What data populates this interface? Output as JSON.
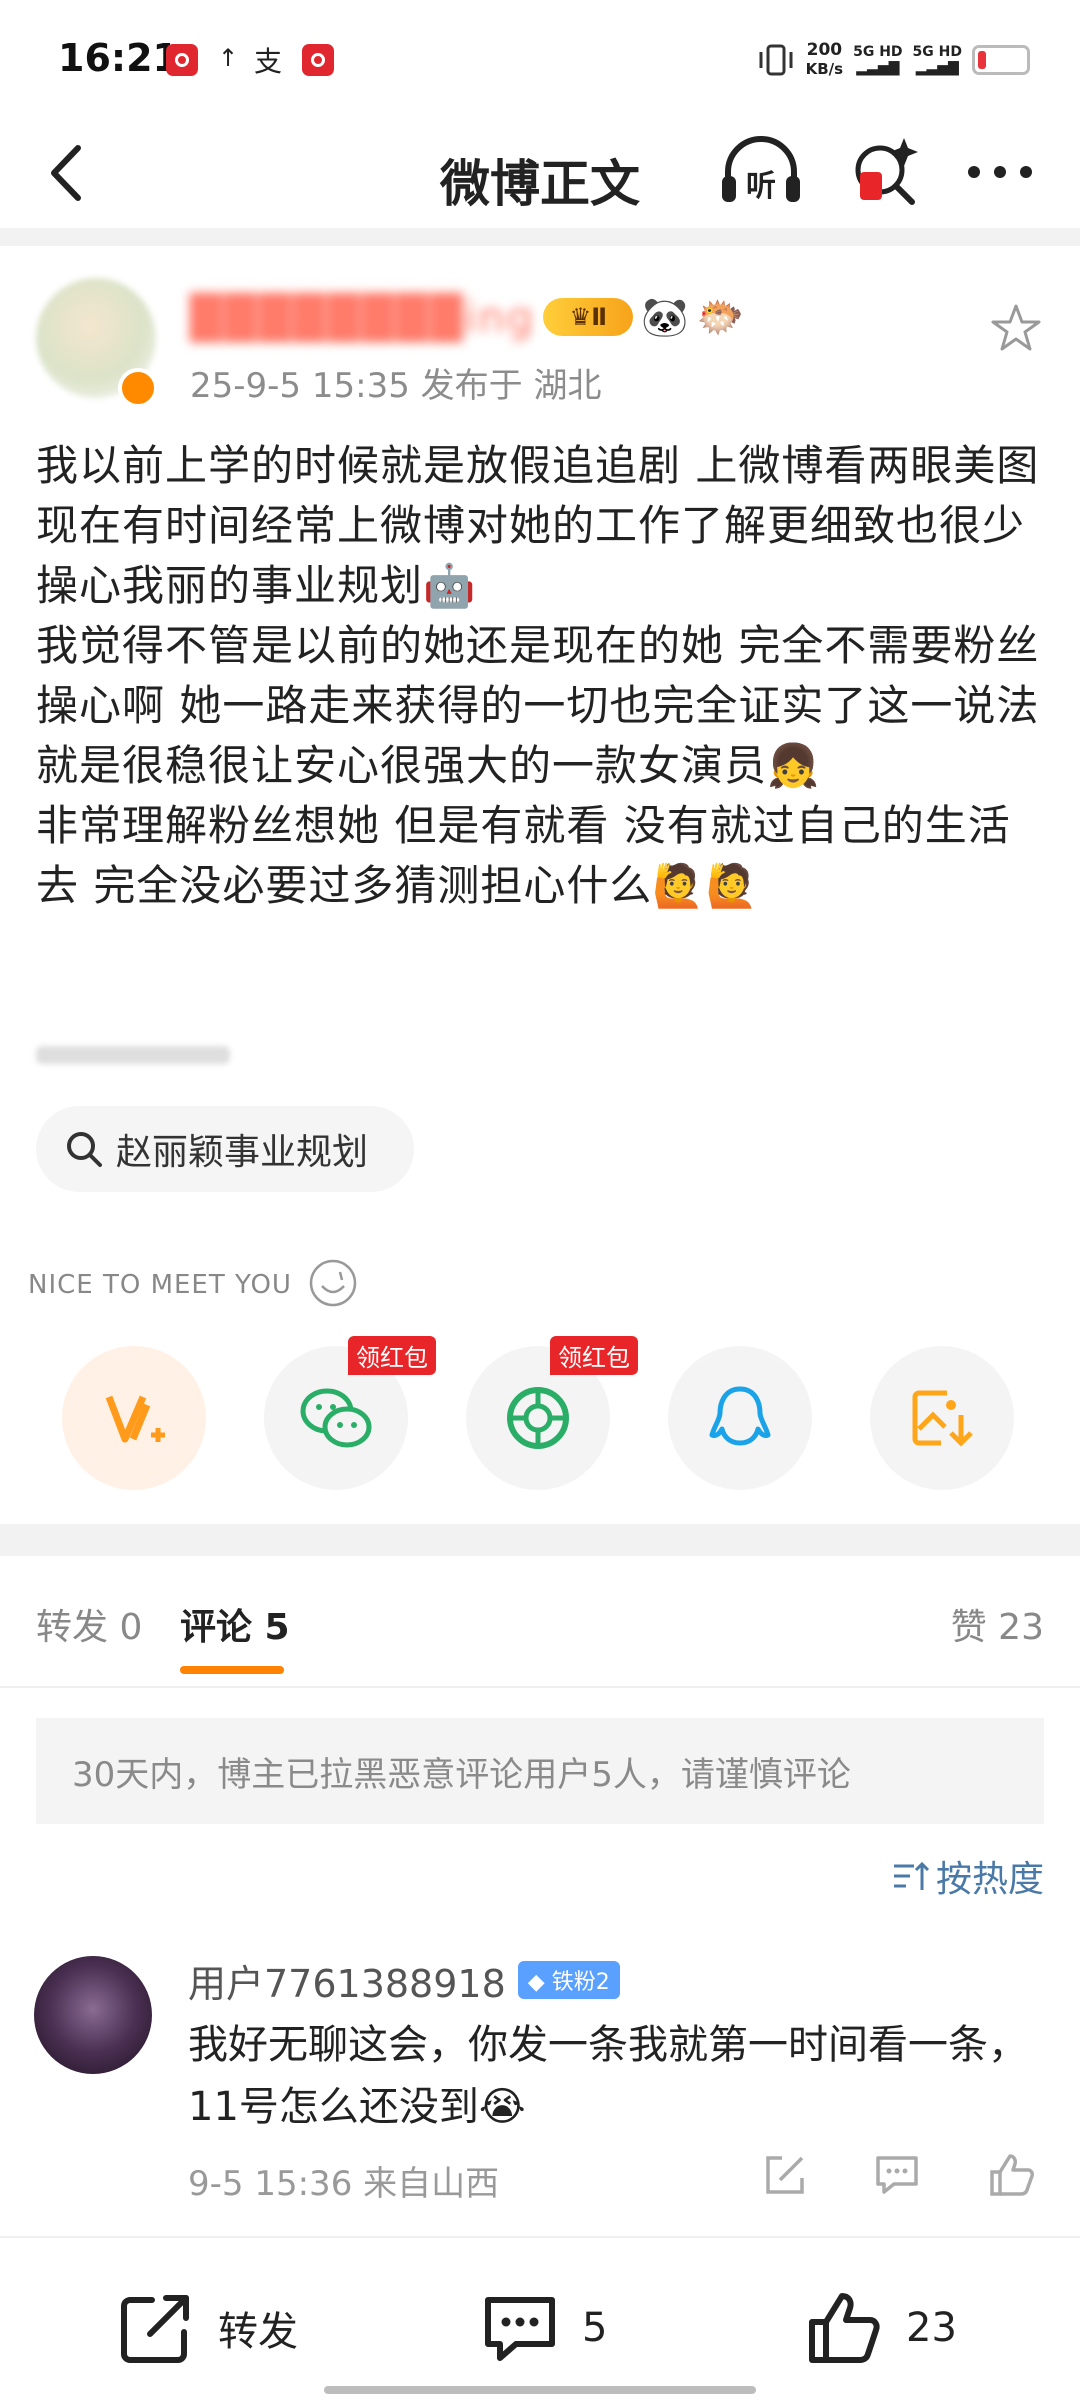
{
  "status_bar": {
    "time": "16:21",
    "upload_arrow": "↑",
    "alipay_glyph": "支",
    "speed_value": "200",
    "speed_unit": "KB/s",
    "network_1": "5G HD",
    "network_2": "5G HD",
    "battery_level": 0.15,
    "battery_color": "#e8333b"
  },
  "header": {
    "title": "微博正文",
    "listen_label": "听"
  },
  "post": {
    "meta": "25-9-5 15:35  发布于 湖北",
    "crown_level": "Ⅱ",
    "badge_emojis": [
      "🐼",
      "🐡"
    ],
    "paragraphs": [
      "我以前上学的时候就是放假追追剧 上微博看两眼美图",
      "现在有时间经常上微博对她的工作了解更细致也很少操心我丽的事业规划🤖",
      "我觉得不管是以前的她还是现在的她 完全不需要粉丝操心啊 她一路走来获得的一切也完全证实了这一说法 就是很稳很让安心很强大的一款女演员👧",
      "非常理解粉丝想她 但是有就看 没有就过自己的生活去 完全没必要过多猜测担心什么🙋🙋"
    ],
    "topic": "赵丽颖事业规划"
  },
  "share": {
    "banner": "NICE TO MEET YOU",
    "red_packet_label": "领红包",
    "items": [
      "v-plus-share",
      "wechat-share",
      "moments-share",
      "qq-share",
      "save-image"
    ]
  },
  "tabs": {
    "repost": "转发 0",
    "comments": "评论 5",
    "likes": "赞 23"
  },
  "notice": "30天内，博主已拉黑恶意评论用户5人，请谨慎评论",
  "sort_label": "按热度",
  "comment": {
    "username": "用户7761388918",
    "fan_badge": "铁粉2",
    "text": "我好无聊这会，你发一条我就第一时间看一条，11号怎么还没到😭",
    "meta": "9-5 15:36  来自山西"
  },
  "bottom_bar": {
    "repost_label": "转发",
    "comment_count": "5",
    "like_count": "23"
  },
  "colors": {
    "accent": "#ff8200",
    "link": "#4a79a8",
    "red_badge": "#e8262a",
    "wechat_green": "#2aae67",
    "qq_blue": "#1aa3e8",
    "vip_orange": "#ff9a1a"
  }
}
